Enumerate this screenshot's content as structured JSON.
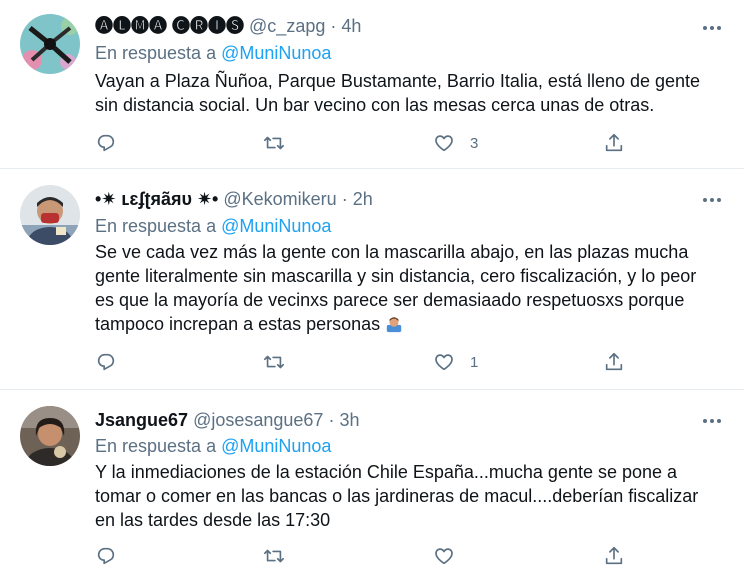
{
  "tweets": [
    {
      "name": "🅐🅛🅜🅐 🅒🅡🅘🅢",
      "handle": "@c_zapg",
      "time": "4h",
      "reply_prefix": "En respuesta a",
      "reply_to": "@MuniNunoa",
      "text_lines": [
        "Vayan a Plaza Ñuñoa, Parque Bustamante, Barrio Italia, está lleno de gente",
        "sin distancia social. Un bar vecino con las mesas cerca unas de otras."
      ],
      "like_count": "3"
    },
    {
      "name": "•✷ ʟɛʄʈяãяυ ✷•",
      "handle": "@Kekomikeru",
      "time": "2h",
      "reply_prefix": "En respuesta a",
      "reply_to": "@MuniNunoa",
      "text_lines": [
        "Se ve cada vez más la gente con la mascarilla  abajo, en las plazas mucha",
        "gente literalmente sin mascarilla y sin distancia, cero fiscalización, y lo peor",
        "es que la mayoría de vecinxs parece ser demasiaado respetuosxs porque",
        "tampoco increpan a estas personas"
      ],
      "like_count": "1"
    },
    {
      "name": "Jsangue67",
      "handle": "@josesangue67",
      "time": "3h",
      "reply_prefix": "En respuesta a",
      "reply_to": "@MuniNunoa",
      "text_lines": [
        "Y la inmediaciones de la estación Chile España...mucha gente se pone a",
        "tomar o comer en las bancas o las jardineras de macul....deberían fiscalizar",
        "en las tardes desde las 17:30"
      ],
      "like_count": ""
    }
  ],
  "separator": "·",
  "icons": {
    "reply": "reply-icon",
    "retweet": "retweet-icon",
    "like": "like-icon",
    "share": "share-icon",
    "more": "more-icon",
    "emoji": "person-bowing-emoji"
  },
  "colors": {
    "mention": "#1da1f2",
    "secondary": "#5b7083",
    "divider": "#e6ecf0"
  }
}
